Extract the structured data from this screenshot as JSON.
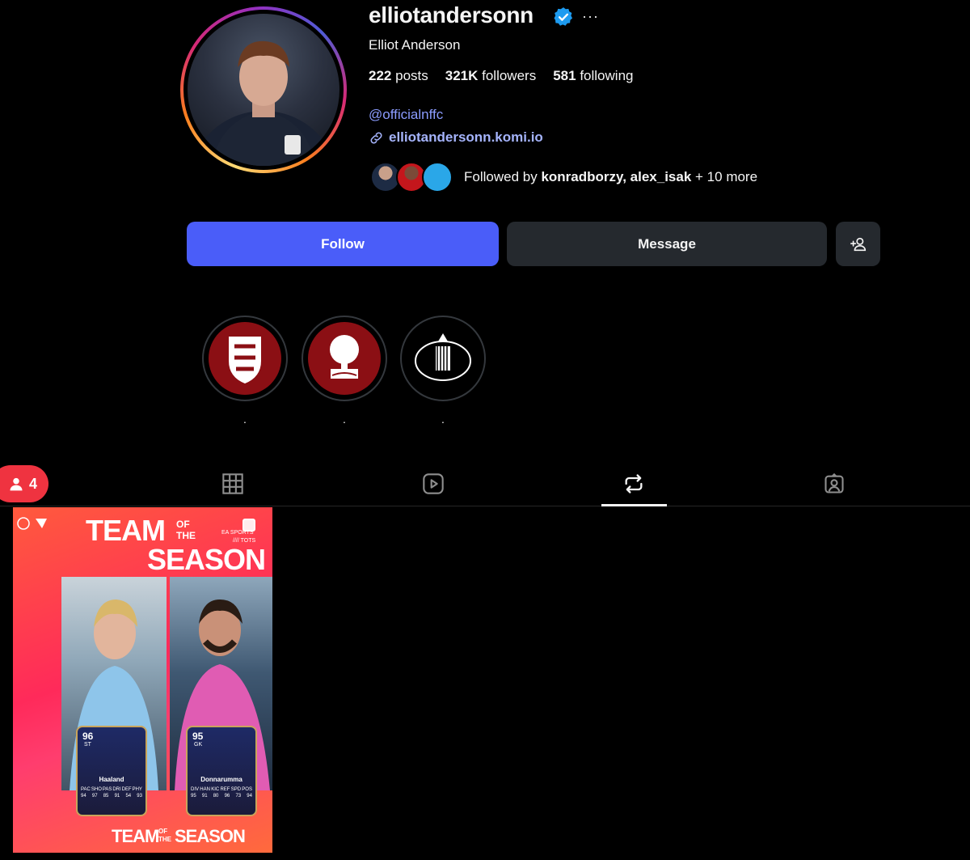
{
  "profile": {
    "username": "elliotandersonn",
    "full_name": "Elliot Anderson",
    "more_glyph": "···",
    "stats": {
      "posts_num": "222",
      "posts_label": "posts",
      "followers_num": "321K",
      "followers_label": "followers",
      "following_num": "581",
      "following_label": "following"
    },
    "handle": "@officialnffc",
    "website": "elliotandersonn.komi.io",
    "followed_by": {
      "prefix": "Followed by",
      "names": "konradborzy, alex_isak",
      "suffix": "+ 10 more"
    }
  },
  "actions": {
    "follow": "Follow",
    "message": "Message"
  },
  "highlights": [
    {
      "label": ".",
      "icon": "england-crest-icon"
    },
    {
      "label": ".",
      "icon": "forest-crest-icon"
    },
    {
      "label": ".",
      "icon": "newcastle-crest-icon"
    }
  ],
  "badge": {
    "count": "4"
  },
  "tabs": [
    "grid-icon",
    "reels-icon",
    "reposts-icon",
    "tagged-icon"
  ],
  "post": {
    "title_top_a": "TEAM",
    "title_top_of": "OF",
    "title_top_the": "THE",
    "title_top_b": "SEASON",
    "brand": "EA SPORTS",
    "tots": "//// TOTS",
    "bottom_a": "TEAM",
    "bottom_of": "OF",
    "bottom_the": "THE",
    "bottom_b": "SEASON",
    "left_card": {
      "rating": "96",
      "pos": "ST",
      "name": "Haaland",
      "stat_labels": [
        "PAC",
        "SHO",
        "PAS",
        "DRI",
        "DEF",
        "PHY"
      ],
      "stat_values": [
        "94",
        "97",
        "85",
        "91",
        "54",
        "93"
      ]
    },
    "right_card": {
      "rating": "95",
      "pos": "GK",
      "name": "Donnarumma",
      "stat_labels": [
        "DIV",
        "HAN",
        "KIC",
        "REF",
        "SPD",
        "POS"
      ],
      "stat_values": [
        "95",
        "91",
        "80",
        "96",
        "73",
        "94"
      ]
    }
  },
  "colors": {
    "accent": "#4a5df9",
    "link": "#8b9cff",
    "badge": "#ef3340",
    "button_secondary": "#25292e"
  }
}
